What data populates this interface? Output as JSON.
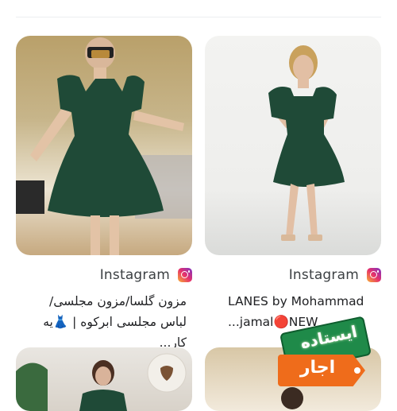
{
  "results": [
    {
      "source": "Instagram",
      "caption": "مزون گلسا/مزون مجلسی/لباس مجلسی ابرکوه | 👗یه کار...",
      "image_alt": "woman in green puff-sleeve dress with headscarf mask"
    },
    {
      "source": "Instagram",
      "caption": "LANES by Mohammad ...jamal🔴NEW",
      "image_alt": "woman in green puff-sleeve dress against white wall"
    }
  ],
  "badge": {
    "top_text": "ایستاده",
    "bottom_text": "اجار"
  },
  "colors": {
    "dress_green": "#1f4a37",
    "instagram_gradient": [
      "#f9b234",
      "#e6306b",
      "#7b34c7"
    ],
    "badge_green": "#1f8a49",
    "badge_orange": "#ef6c1b"
  }
}
